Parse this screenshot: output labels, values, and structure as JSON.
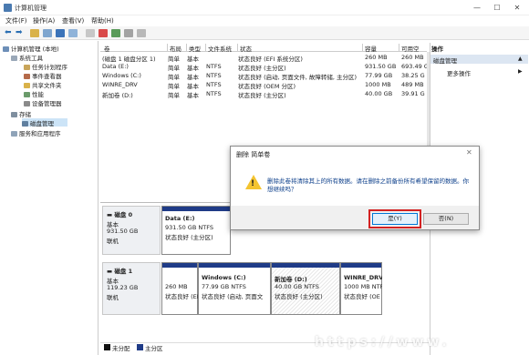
{
  "window": {
    "title": "计算机管理",
    "min": "—",
    "max": "☐",
    "close": "✕"
  },
  "menu": [
    "文件(F)",
    "操作(A)",
    "查看(V)",
    "帮助(H)"
  ],
  "tree": [
    {
      "label": "计算机管理 (本地)",
      "indent": 0
    },
    {
      "label": "系统工具",
      "indent": 1
    },
    {
      "label": "任务计划程序",
      "indent": 2
    },
    {
      "label": "事件查看器",
      "indent": 2
    },
    {
      "label": "共享文件夹",
      "indent": 2
    },
    {
      "label": "性能",
      "indent": 2
    },
    {
      "label": "设备管理器",
      "indent": 2
    },
    {
      "label": "存储",
      "indent": 1
    },
    {
      "label": "磁盘管理",
      "indent": 2
    },
    {
      "label": "服务和应用程序",
      "indent": 1
    }
  ],
  "table": {
    "headers": [
      "卷",
      "布局",
      "类型",
      "文件系统",
      "状态",
      "容量",
      "可用空"
    ],
    "rows": [
      [
        "(磁盘 1 磁盘分区 1)",
        "简单",
        "基本",
        "",
        "状态良好 (EFI 系统分区)",
        "260 MB",
        "260 MB"
      ],
      [
        "Data (E:)",
        "简单",
        "基本",
        "NTFS",
        "状态良好 (主分区)",
        "931.50 GB",
        "693.49 G"
      ],
      [
        "Windows (C:)",
        "简单",
        "基本",
        "NTFS",
        "状态良好 (启动, 页面文件, 故障转储, 主分区)",
        "77.99 GB",
        "38.25 G"
      ],
      [
        "WINRE_DRV",
        "简单",
        "基本",
        "NTFS",
        "状态良好 (OEM 分区)",
        "1000 MB",
        "489 MB"
      ],
      [
        "新加卷 (D:)",
        "简单",
        "基本",
        "NTFS",
        "状态良好 (主分区)",
        "40.00 GB",
        "39.91 G"
      ]
    ]
  },
  "actions": {
    "header": "操作",
    "section": "磁盘管理",
    "more": "更多操作",
    "arrow_up": "▲",
    "arrow_right": "▶"
  },
  "disk0": {
    "name": "磁盘 0",
    "type": "基本",
    "size": "931.50 GB",
    "status": "联机",
    "partitions": [
      {
        "name": "Data (E:)",
        "size": "931.50 GB NTFS",
        "status": "状态良好 (主分区)"
      }
    ]
  },
  "disk1": {
    "name": "磁盘 1",
    "type": "基本",
    "size": "119.23 GB",
    "status": "联机",
    "partitions": [
      {
        "name": "",
        "size": "260 MB",
        "status": "状态良好 (EFI"
      },
      {
        "name": "Windows (C:)",
        "size": "77.99 GB NTFS",
        "status": "状态良好 (启动, 页面文"
      },
      {
        "name": "新加卷 (D:)",
        "size": "40.00 GB NTFS",
        "status": "状态良好 (主分区)"
      },
      {
        "name": "WINRE_DRV",
        "size": "1000 MB NTFS",
        "status": "状态良好 (OE"
      }
    ]
  },
  "legend": {
    "unallocated": "未分配",
    "primary": "主分区"
  },
  "dialog": {
    "title": "删除 简单卷",
    "close": "✕",
    "message": "删除此卷将清除其上的所有数据。请在删除之前备份所有希望保留的数据。你想继续吗？",
    "yes": "是(Y)",
    "no": "否(N)",
    "warn_mark": "!"
  },
  "watermark": "https://www.",
  "colors": {
    "primary_partition": "#1f3b87",
    "unallocated": "#111111",
    "selected": "#cce4f7",
    "highlight": "#d32222"
  }
}
